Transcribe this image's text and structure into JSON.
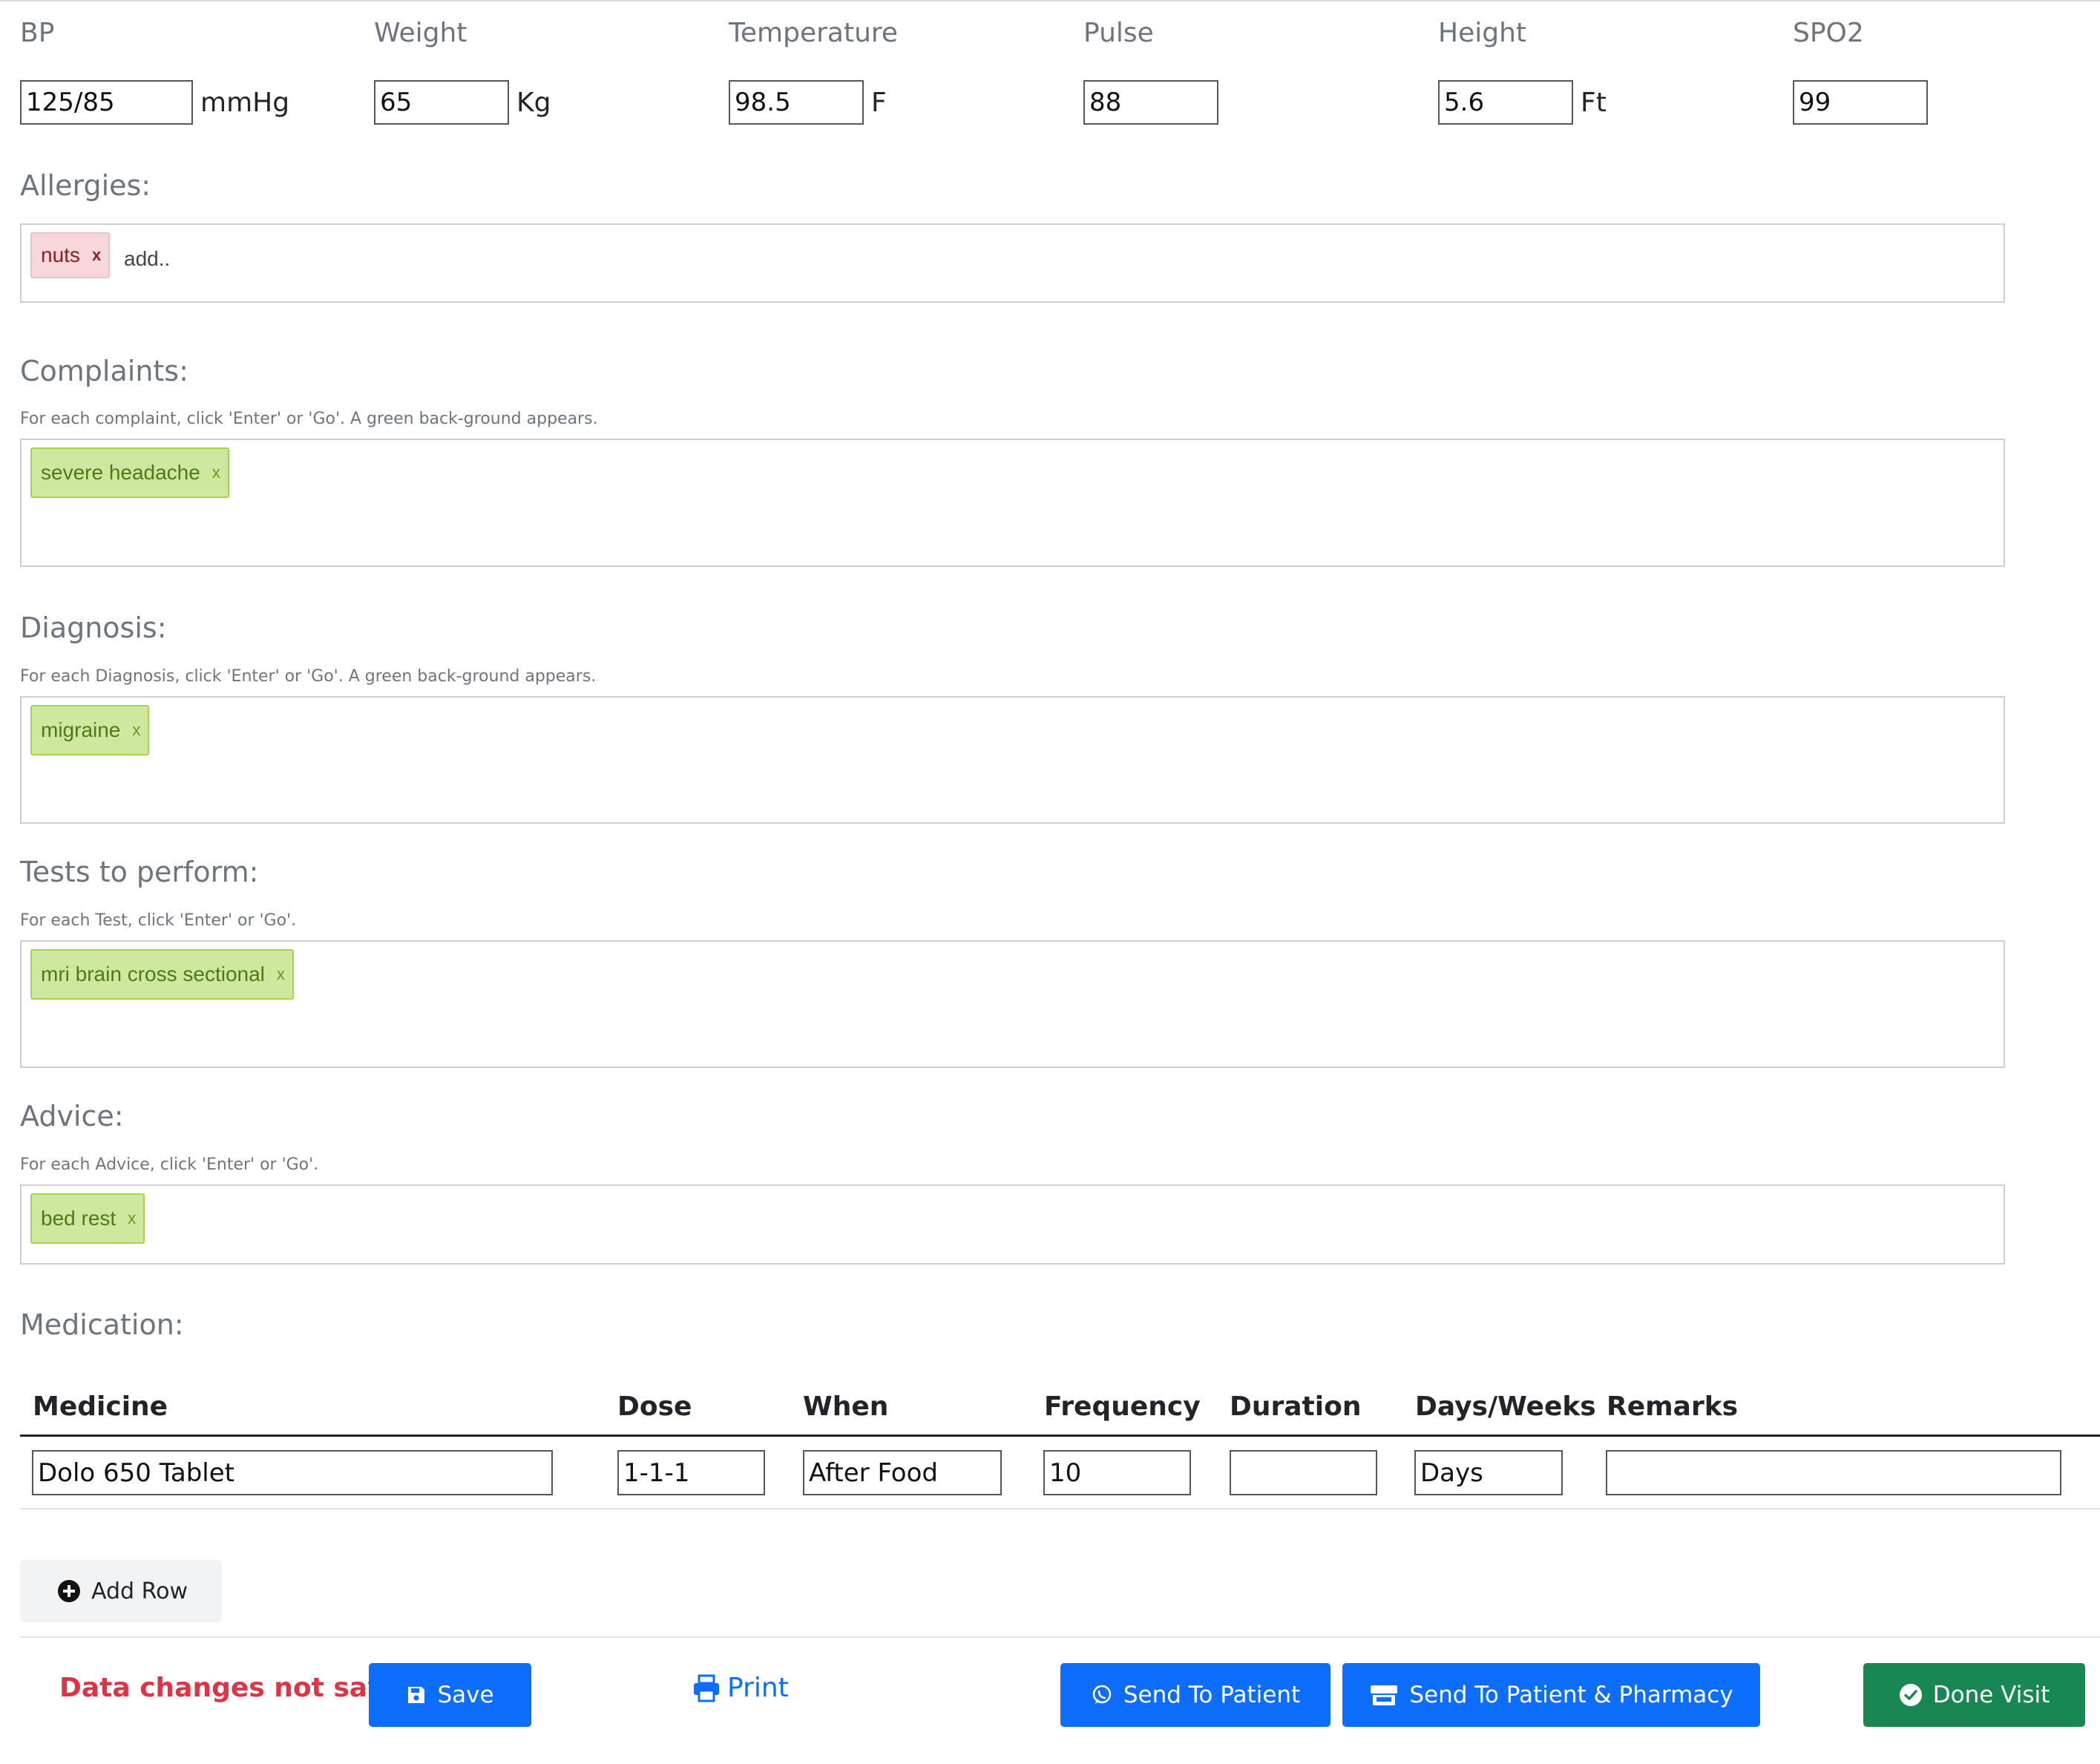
{
  "vitals": {
    "bp": {
      "label": "BP",
      "value": "125/85",
      "unit": "mmHg"
    },
    "weight": {
      "label": "Weight",
      "value": "65",
      "unit": "Kg"
    },
    "temperature": {
      "label": "Temperature",
      "value": "98.5",
      "unit": "F"
    },
    "pulse": {
      "label": "Pulse",
      "value": "88"
    },
    "height": {
      "label": "Height",
      "value": "5.6",
      "unit": "Ft"
    },
    "spo2": {
      "label": "SPO2",
      "value": "99"
    }
  },
  "allergies": {
    "title": "Allergies:",
    "tags": [
      "nuts"
    ],
    "tag_remove": "x",
    "placeholder": "add.."
  },
  "complaints": {
    "title": "Complaints:",
    "hint": "For each complaint, click 'Enter' or 'Go'. A green back-ground appears.",
    "tags": [
      "severe headache"
    ],
    "tag_remove": "x"
  },
  "diagnosis": {
    "title": "Diagnosis:",
    "hint": "For each Diagnosis, click 'Enter' or 'Go'. A green back-ground appears.",
    "tags": [
      "migraine"
    ],
    "tag_remove": "x"
  },
  "tests": {
    "title": "Tests to perform:",
    "hint": "For each Test, click 'Enter' or 'Go'.",
    "tags": [
      "mri brain cross sectional"
    ],
    "tag_remove": "x"
  },
  "advice": {
    "title": "Advice:",
    "hint": "For each Advice, click 'Enter' or 'Go'.",
    "tags": [
      "bed rest"
    ],
    "tag_remove": "x"
  },
  "medication": {
    "title": "Medication:",
    "columns": [
      "Medicine",
      "Dose",
      "When",
      "Frequency",
      "Duration",
      "Days/Weeks",
      "Remarks"
    ],
    "rows": [
      {
        "medicine": "Dolo 650 Tablet",
        "dose": "1-1-1",
        "when": "After Food",
        "frequency": "10",
        "duration": "",
        "days_weeks": "Days",
        "remarks": ""
      }
    ],
    "add_row_label": "Add Row"
  },
  "footer": {
    "status": "Data changes not saved.",
    "save_label": "Save",
    "print_label": "Print",
    "send_patient_label": "Send To Patient",
    "send_pharmacy_label": "Send To Patient & Pharmacy",
    "done_label": "Done Visit"
  },
  "colors": {
    "primary": "#0d6efd",
    "success": "#198754",
    "danger": "#dc3545",
    "tag_green_bg": "#cfe8a0",
    "tag_red_bg": "#f8d7da"
  },
  "icons": {
    "add_row": "plus-circle-icon",
    "save": "floppy-disk-icon",
    "print": "printer-icon",
    "send_patient": "whatsapp-icon",
    "send_pharmacy": "store-icon",
    "done": "check-circle-icon"
  }
}
